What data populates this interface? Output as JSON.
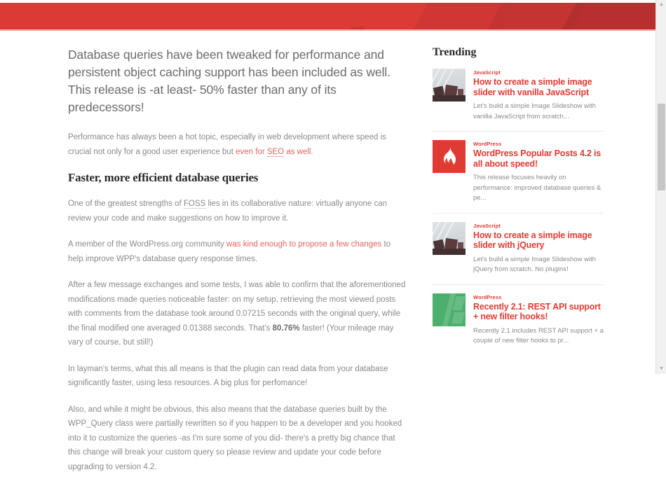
{
  "header": {
    "accent_color": "#dc3a35",
    "accent_dark": "#b02e2e"
  },
  "article": {
    "lead": "Database queries have been tweaked for performance and persistent object caching support has been included as well. This release is -at least- 50% faster than any of its predecessors!",
    "para1_before": "Performance has always been a hot topic, especially in web development where speed is crucial not only for a good user experience but ",
    "para1_link_a": "even for ",
    "para1_link_abbr": "SEO",
    "para1_link_b": " as well.",
    "section_title": "Faster, more efficient database queries",
    "para2_before": "One of the greatest strengths of ",
    "para2_abbr": "FOSS",
    "para2_after": " lies in its collaborative nature: virtually anyone can review your code and make suggestions on how to improve it.",
    "para3_before": "A member of the WordPress.org community ",
    "para3_link": "was kind enough to propose a few changes",
    "para3_after": " to help improve WPP's database query response times.",
    "para4_before": "After a few message exchanges and some tests, I was able to confirm that the aforementioned modifications made queries noticeable faster: on my setup, retrieving the most viewed posts with comments from the database took around 0.07215 seconds with the original query, while the final modified one averaged 0.01388 seconds. That's ",
    "para4_bold": "80.76%",
    "para4_after": " faster! (Your mileage may vary of course, but still!)",
    "para5": "In layman's terms, what this all means is that the plugin can read data from your database significantly faster, using less resources. A big plus for perfomance!",
    "para6": "Also, and while it might be obvious, this also means that the database queries built by the WPP_Query class were partially rewritten so if you happen to be a developer and you hooked into it to customize the queries -as I'm sure some of you did- there's a pretty big chance that this change will break your custom query so please review and update your code before upgrading to version 4.2."
  },
  "sidebar": {
    "title": "Trending",
    "items": [
      {
        "category": "JavaScript",
        "title": "How to create a simple image slider with vanilla JavaScript",
        "excerpt": "Let's build a simple Image Slideshow with vanilla JavaScript from scratch...",
        "thumb_type": "photo"
      },
      {
        "category": "WordPress",
        "title": "WordPress Popular Posts 4.2 is all about speed!",
        "excerpt": "This release focuses heavily on performance: improved database queries & pe...",
        "thumb_type": "flame",
        "thumb_color": "#e03b33"
      },
      {
        "category": "JavaScript",
        "title": "How to create a simple image slider with jQuery",
        "excerpt": "Let's build a simple Image Slideshow with jQuery from scratch. No plugins!",
        "thumb_type": "photo"
      },
      {
        "category": "WordPress",
        "title": "Recently 2.1: REST API support + new filter hooks!",
        "excerpt": "Recently 2.1 includes REST API support + a couple of new filter hooks to pr...",
        "thumb_type": "green",
        "thumb_color": "#4caf6d"
      }
    ]
  },
  "scrollbar": {
    "up_arrow": "▲",
    "down_arrow": "▼"
  }
}
